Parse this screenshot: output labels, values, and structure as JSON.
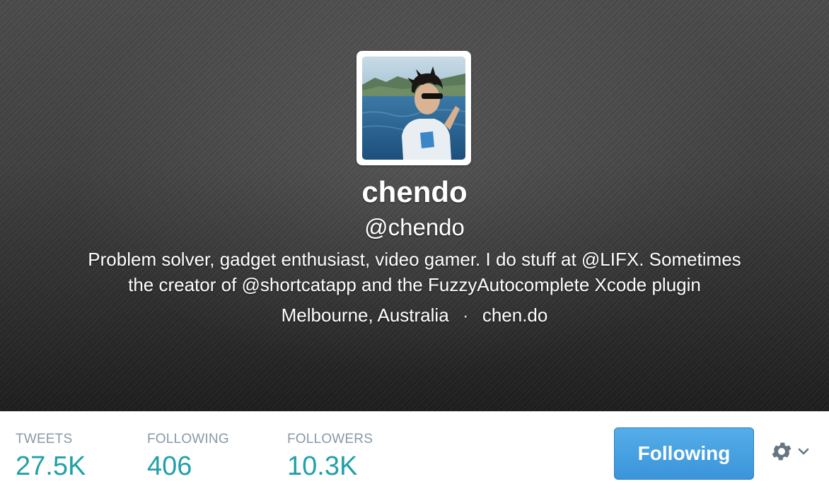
{
  "profile": {
    "name": "chendo",
    "handle": "@chendo",
    "bio_line1": "Problem solver, gadget enthusiast, video gamer. I do stuff at @LIFX. Sometimes",
    "bio_line2": "the creator of @shortcatapp and the FuzzyAutocomplete Xcode plugin",
    "location": "Melbourne, Australia",
    "separator": "·",
    "website": "chen.do"
  },
  "stats": [
    {
      "label": "TWEETS",
      "value": "27.5K"
    },
    {
      "label": "FOLLOWING",
      "value": "406"
    },
    {
      "label": "FOLLOWERS",
      "value": "10.3K"
    }
  ],
  "actions": {
    "follow_label": "Following",
    "settings_icon": "gear-icon",
    "dropdown_icon": "chevron-down-icon"
  },
  "colors": {
    "accent": "#21a0a8",
    "button": "#4aa5e3",
    "stat_label": "#8899a6"
  }
}
